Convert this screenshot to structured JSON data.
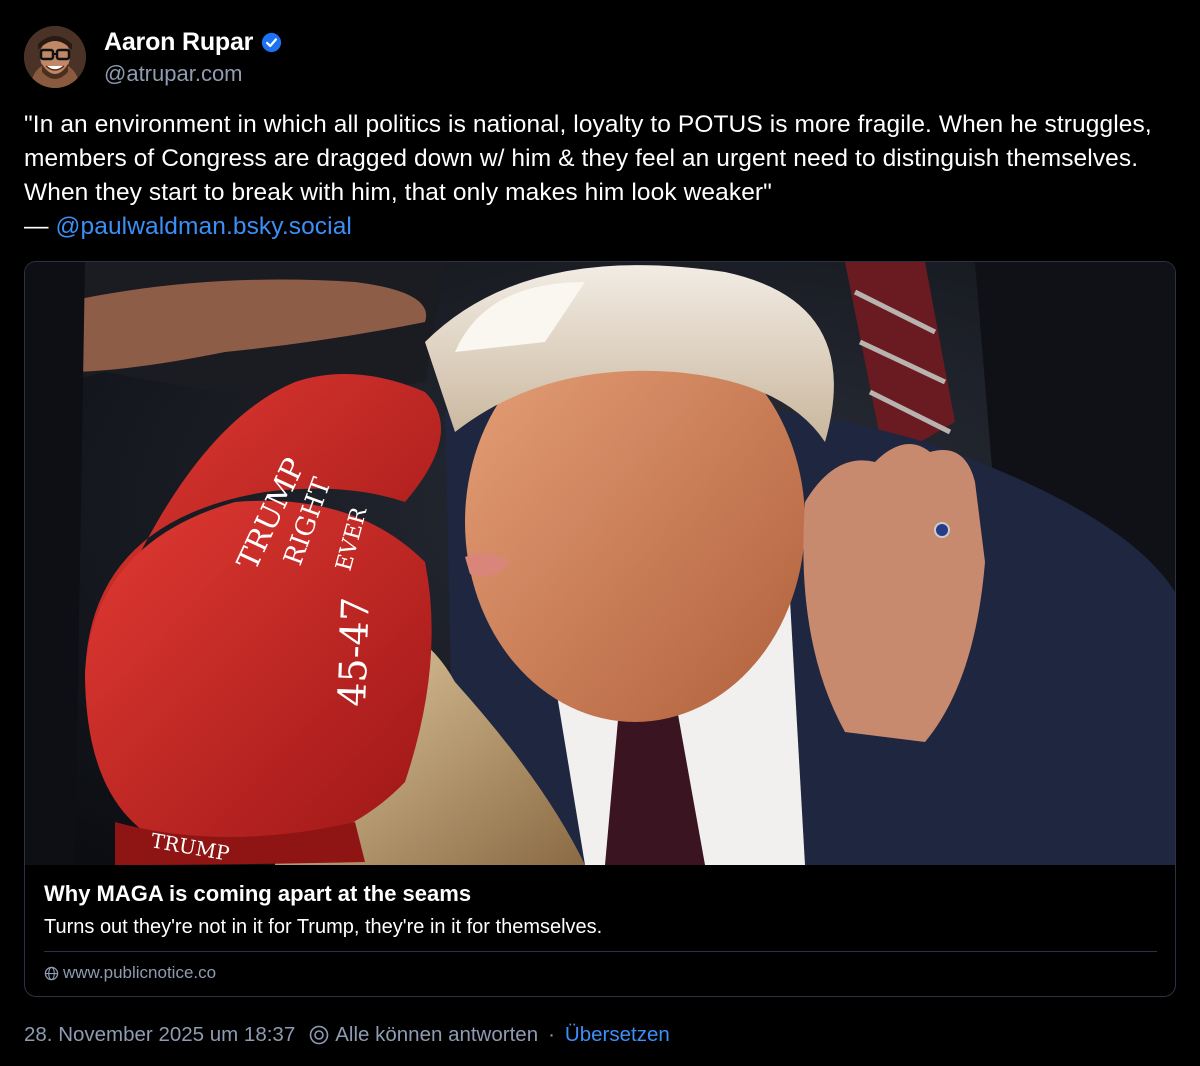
{
  "author": {
    "display_name": "Aaron Rupar",
    "handle": "@atrupar.com"
  },
  "post": {
    "text": "\"In an environment in which all politics is national, loyalty to POTUS is more fragile. When he struggles, members of Congress are dragged down w/ him & they feel an urgent need to distinguish themselves. When they start to break with him, that only makes him look weaker\"\n— ",
    "mention": "@paulwaldman.bsky.social"
  },
  "link_card": {
    "title": "Why MAGA is coming apart at the seams",
    "description": "Turns out they're not in it for Trump, they're in it for themselves.",
    "domain": "www.publicnotice.co",
    "image_text": {
      "hat_front": "45-47",
      "hat_side_1": "TRUMP",
      "hat_side_2": "RIGHT",
      "hat_side_3": "EVER",
      "hat_brim": "TRUMP"
    }
  },
  "footer": {
    "timestamp": "28. November 2025 um 18:37",
    "reply_setting": "Alle können antworten",
    "separator": "·",
    "translate": "Übersetzen"
  },
  "colors": {
    "background": "#000000",
    "accent": "#3b8ff6",
    "muted": "#8e9bb0",
    "verified": "#1d72f3",
    "hat_red": "#d42a2a"
  },
  "icons": [
    "verified-badge-icon",
    "globe-icon",
    "reply-settings-icon"
  ]
}
